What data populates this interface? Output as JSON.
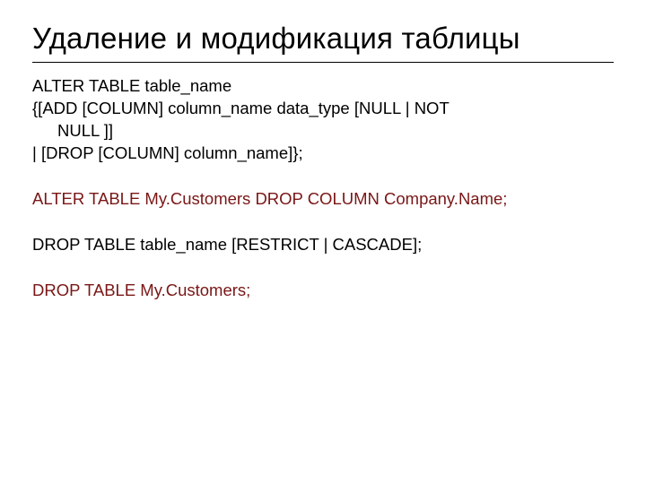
{
  "title": "Удаление и модификация таблицы",
  "p1_l1": "ALTER TABLE table_name",
  "p1_l2": "{[ADD [COLUMN] column_name data_type [NULL | NOT",
  "p1_l3": "NULL ]]",
  "p1_l4": "| [DROP [COLUMN] column_name]};",
  "p2": "ALTER TABLE My.Customers DROP COLUMN Company.Name;",
  "p3": "DROP TABLE table_name [RESTRICT | CASCADE];",
  "p4": "DROP TABLE My.Customers;"
}
